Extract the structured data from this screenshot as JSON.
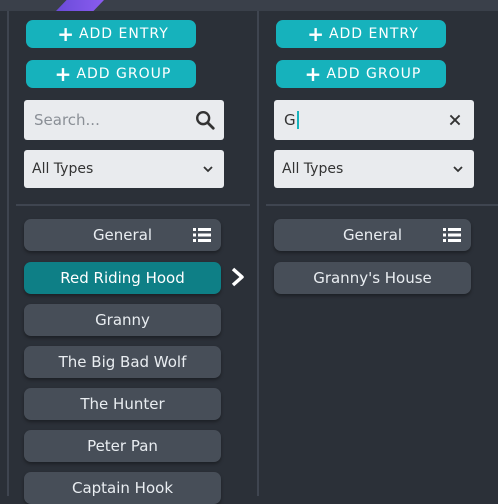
{
  "left": {
    "add_entry": "ADD ENTRY",
    "add_group": "ADD GROUP",
    "search": {
      "value": "",
      "placeholder": "Search..."
    },
    "type_filter": "All Types",
    "items": [
      {
        "label": "General",
        "icon": "list-icon"
      },
      {
        "label": "Red Riding Hood",
        "active": true
      },
      {
        "label": "Granny"
      },
      {
        "label": "The Big Bad Wolf"
      },
      {
        "label": "The Hunter"
      },
      {
        "label": "Peter Pan"
      },
      {
        "label": "Captain Hook"
      }
    ]
  },
  "right": {
    "add_entry": "ADD ENTRY",
    "add_group": "ADD GROUP",
    "search": {
      "value": "G",
      "placeholder": ""
    },
    "type_filter": "All Types",
    "items": [
      {
        "label": "General",
        "icon": "list-icon"
      },
      {
        "label": "Granny's House"
      }
    ]
  },
  "colors": {
    "accent": "#16b2bc",
    "active_item": "#0e7f86",
    "item_bg": "#474e58",
    "background": "#2b3038"
  }
}
